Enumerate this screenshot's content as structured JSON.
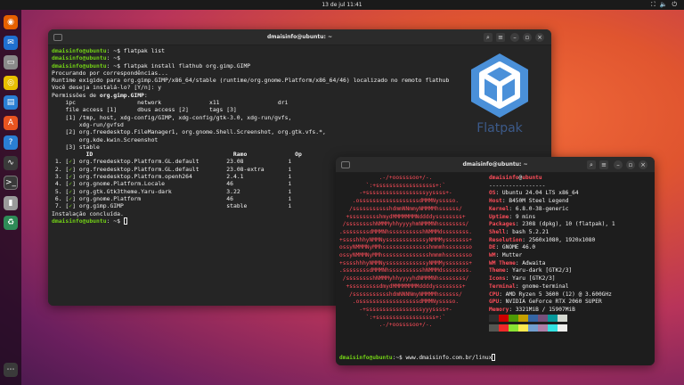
{
  "topbar": {
    "clock": "13 de jul  11:41"
  },
  "dock": {
    "apps": [
      "firefox-icon",
      "thunderbird-icon",
      "files-icon",
      "rhythmbox-icon",
      "writer-icon",
      "app-center-icon",
      "help-icon",
      "system-monitor-icon",
      "terminal-icon",
      "usb-icon",
      "trash-icon",
      "show-apps-icon"
    ]
  },
  "term1": {
    "title": "dmaisinfo@ubuntu: ~",
    "prompt": "dmaisinfo@ubuntu",
    "lines": [
      {
        "p": true,
        "cmd": ": ~$ flatpak list"
      },
      {
        "p": true,
        "cmd": ": ~$"
      },
      {
        "p": true,
        "cmd": ": ~$ flatpak install flathub org.gimp.GIMP"
      },
      {
        "t": "Procurando por correspondências..."
      },
      {
        "t": "Runtime exigido para org.gimp.GIMP/x86_64/stable (runtime/org.gnome.Platform/x86_64/46) localizado no remoto flathub"
      },
      {
        "t": "Você deseja instalá-lo? [Y/n]: y"
      },
      {
        "t": ""
      },
      {
        "t": "Permissões de ",
        "bold": "org.gimp.GIMP",
        "after": ":"
      },
      {
        "t": "    ipc                  network              x11                 dri"
      },
      {
        "t": "    file access [1]      dbus access [2]      tags [3]"
      },
      {
        "t": ""
      },
      {
        "t": "    [1] /tmp, host, xdg-config/GIMP, xdg-config/gtk-3.0, xdg-run/gvfs,"
      },
      {
        "t": "        xdg-run/gvfsd"
      },
      {
        "t": "    [2] org.freedesktop.FileManager1, org.gnome.Shell.Screenshot, org.gtk.vfs.*,"
      },
      {
        "t": "        org.kde.kwin.Screenshot"
      },
      {
        "t": "    [3] stable"
      },
      {
        "t": ""
      },
      {
        "t": "          ID                                         Ramo              Op",
        "hdr": true
      }
    ],
    "table": [
      {
        "n": "1.",
        "id": "org.freedesktop.Platform.GL.default",
        "ramo": "23.08",
        "op": "i"
      },
      {
        "n": "2.",
        "id": "org.freedesktop.Platform.GL.default",
        "ramo": "23.08-extra",
        "op": "i"
      },
      {
        "n": "3.",
        "id": "org.freedesktop.Platform.openh264",
        "ramo": "2.4.1",
        "op": "i"
      },
      {
        "n": "4.",
        "id": "org.gnome.Platform.Locale",
        "ramo": "46",
        "op": "i"
      },
      {
        "n": "5.",
        "id": "org.gtk.Gtk3theme.Yaru-dark",
        "ramo": "3.22",
        "op": "i"
      },
      {
        "n": "6.",
        "id": "org.gnome.Platform",
        "ramo": "46",
        "op": "i"
      },
      {
        "n": "7.",
        "id": "org.gimp.GIMP",
        "ramo": "stable",
        "op": "i"
      }
    ],
    "done": "Instalação concluída."
  },
  "flatpak_logo": {
    "word": "Flatpak"
  },
  "term2": {
    "title": "dmaisinfo@ubuntu: ~",
    "user": "dmaisinfo",
    "host": "ubuntu",
    "sep": "-----------------",
    "info": [
      {
        "k": "OS",
        "v": "Ubuntu 24.04 LTS x86_64"
      },
      {
        "k": "Host",
        "v": "B450M Steel Legend"
      },
      {
        "k": "Kernel",
        "v": "6.8.0-38-generic"
      },
      {
        "k": "Uptime",
        "v": "9 mins"
      },
      {
        "k": "Packages",
        "v": "2308 (dpkg), 10 (flatpak), 1"
      },
      {
        "k": "Shell",
        "v": "bash 5.2.21"
      },
      {
        "k": "Resolution",
        "v": "2560x1080, 1920x1080"
      },
      {
        "k": "DE",
        "v": "GNOME 46.0"
      },
      {
        "k": "WM",
        "v": "Mutter"
      },
      {
        "k": "WM Theme",
        "v": "Adwaita"
      },
      {
        "k": "Theme",
        "v": "Yaru-dark [GTK2/3]"
      },
      {
        "k": "Icons",
        "v": "Yaru [GTK2/3]"
      },
      {
        "k": "Terminal",
        "v": "gnome-terminal"
      },
      {
        "k": "CPU",
        "v": "AMD Ryzen 5 3600 (12) @ 3.600GHz"
      },
      {
        "k": "GPU",
        "v": "NVIDIA GeForce RTX 2060 SUPER"
      },
      {
        "k": "Memory",
        "v": "3321MiB / 15907MiB"
      }
    ],
    "art": [
      "            .-/+oossssoo+/-.",
      "        `:+ssssssssssssssssss+:`",
      "      -+ssssssssssssssssssyyssss+-",
      "    .ossssssssssssssssssdMMMNysssso.",
      "   /ssssssssssshdmmNNmmyNMMMMhssssss/",
      "  +ssssssssshmydMMMMMMMNddddyssssssss+",
      " /sssssssshNMMMyhhyyyyhmNMMMNhssssssss/",
      ".ssssssssdMMMNhsssssssssshNMMMdssssssss.",
      "+sssshhhyNMMNyssssssssssssyNMMMysssssss+",
      "ossyNMMMNyMMhsssssssssssssshmmmhssssssso",
      "ossyNMMMNyMMhsssssssssssssshmmmhssssssso",
      "+sssshhhyNMMNyssssssssssssyNMMMysssssss+",
      ".ssssssssdMMMNhsssssssssshNMMMdssssssss.",
      " /sssssssshNMMMyhhyyyyhdNMMMNhssssssss/",
      "  +sssssssssdmydMMMMMMMMddddyssssssss+",
      "   /ssssssssssshdmNNNNmyNMMMMhssssss/",
      "    .ossssssssssssssssssdMMMNysssso.",
      "      -+sssssssssssssssssyyyssss+-",
      "        `:+ssssssssssssssssss+:`",
      "            .-/+oossssoo+/-."
    ],
    "palette_top": [
      "#2e2e2e",
      "#cc0000",
      "#4e9a06",
      "#c4a000",
      "#3465a4",
      "#75507b",
      "#06989a",
      "#d3d7cf"
    ],
    "palette_bottom": [
      "#555753",
      "#ef2929",
      "#8ae234",
      "#fce94f",
      "#729fcf",
      "#ad7fa8",
      "#34e2e2",
      "#eeeeec"
    ],
    "prompt_cmd": ":~$ www.dmaisinfo.com.br/linux"
  }
}
